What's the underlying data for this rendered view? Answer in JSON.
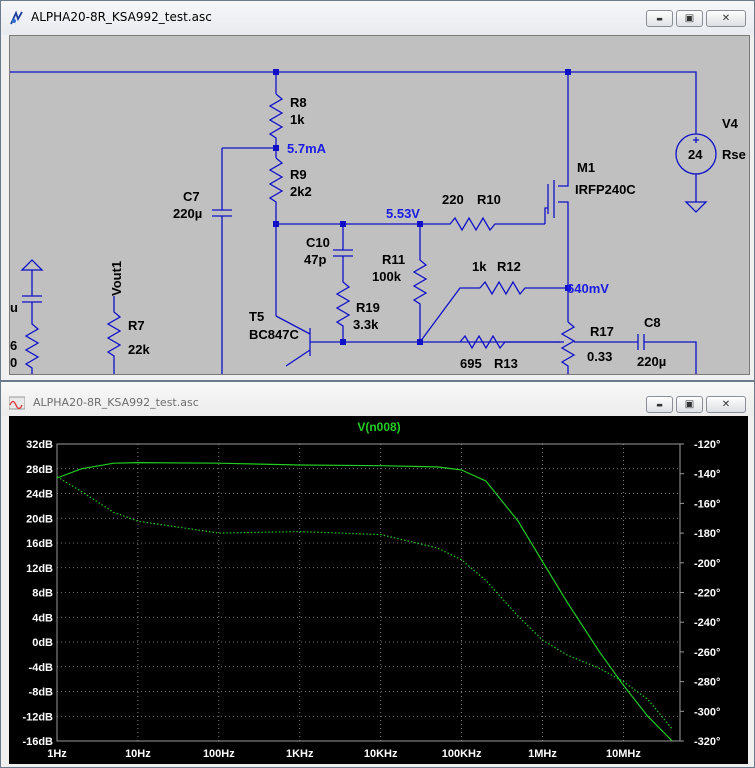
{
  "schematic_window": {
    "title": "ALPHA20-8R_KSA992_test.asc",
    "labels": {
      "r8": "R8",
      "r8v": "1k",
      "r9": "R9",
      "r9v": "2k2",
      "c7": "C7",
      "c7v": "220µ",
      "c10": "C10",
      "c10v": "47p",
      "r11": "R11",
      "r11v": "100k",
      "r19": "R19",
      "r19v": "3.3k",
      "r10v": "220",
      "r10": "R10",
      "r12v": "1k",
      "r12": "R12",
      "r13v": "695",
      "r13": "R13",
      "r17": "R17",
      "r17v": "0.33",
      "c8": "C8",
      "c8v": "220µ",
      "m1": "M1",
      "m1v": "IRFP240C",
      "t5": "T5",
      "t5v": "BC847C",
      "r7": "R7",
      "r7v": "22k",
      "vout1": "Vout1",
      "v4": "V4",
      "v4v": "24",
      "rser": "Rse",
      "edge_u": "u",
      "edge_6": "6",
      "edge_0": "0",
      "op_5_7ma": "5.7mA",
      "op_5_53v": "5.53V",
      "op_640mv": "640mV"
    }
  },
  "plot_window": {
    "title": "ALPHA20-8R_KSA992_test.asc",
    "trace_label": "V(n008)"
  },
  "window_buttons": {
    "minimize": "▬",
    "restore": "▣",
    "close": "✕"
  },
  "colors": {
    "wire": "#1010c8",
    "op_point": "#1a1ae6",
    "trace": "#22cc22",
    "grid": "#9a9a9a",
    "axis_text": "#ffffff"
  },
  "chart_data": {
    "type": "line",
    "x_ticks": [
      "1Hz",
      "10Hz",
      "100Hz",
      "1KHz",
      "10KHz",
      "100KHz",
      "1MHz",
      "10MHz"
    ],
    "y_left_ticks": [
      "32dB",
      "28dB",
      "24dB",
      "20dB",
      "16dB",
      "12dB",
      "8dB",
      "4dB",
      "0dB",
      "-4dB",
      "-8dB",
      "-12dB",
      "-16dB"
    ],
    "y_right_ticks": [
      "-120°",
      "-140°",
      "-160°",
      "-180°",
      "-200°",
      "-220°",
      "-240°",
      "-260°",
      "-280°",
      "-300°",
      "-320°"
    ],
    "xlog": true,
    "x_range_hz": [
      1,
      50000000
    ],
    "y_left_range_db": [
      -16,
      32
    ],
    "y_right_range_deg": [
      -320,
      -120
    ],
    "series": [
      {
        "name": "V(n008)",
        "axis": "left",
        "style": "solid",
        "x": [
          1,
          2,
          5,
          10,
          100,
          1000,
          10000,
          50000,
          100000,
          200000,
          500000,
          1000000,
          2000000,
          5000000,
          10000000,
          20000000,
          40000000
        ],
        "y": [
          26.5,
          28.0,
          28.9,
          29.0,
          28.9,
          28.6,
          28.5,
          28.3,
          27.8,
          26.0,
          19.5,
          13.0,
          6.5,
          -1.5,
          -7.0,
          -12.0,
          -16.0
        ]
      },
      {
        "name": "phase",
        "axis": "right",
        "style": "dotted",
        "x": [
          1,
          2,
          5,
          10,
          100,
          1000,
          10000,
          50000,
          100000,
          200000,
          500000,
          1000000,
          2000000,
          5000000,
          10000000,
          20000000,
          40000000
        ],
        "y": [
          -142,
          -152,
          -166,
          -172,
          -180,
          -179,
          -181,
          -190,
          -198,
          -212,
          -236,
          -252,
          -262,
          -271,
          -280,
          -292,
          -312
        ]
      }
    ]
  }
}
